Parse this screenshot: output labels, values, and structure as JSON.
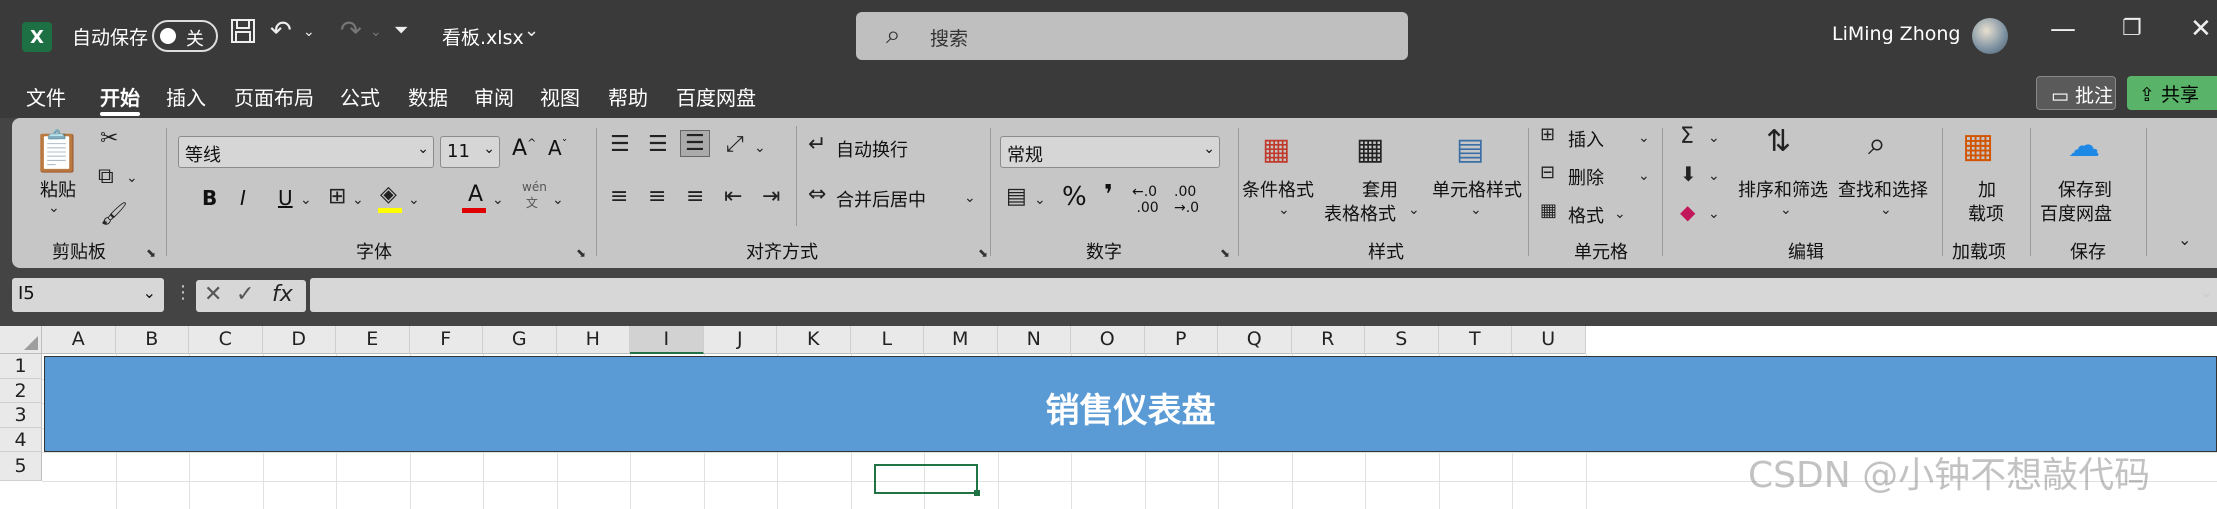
{
  "titlebar": {
    "autosave_label": "自动保存",
    "autosave_state": "关",
    "filename": "看板.xlsx",
    "search_placeholder": "搜索",
    "user_name": "LiMing Zhong"
  },
  "menu": {
    "tabs": [
      "文件",
      "开始",
      "插入",
      "页面布局",
      "公式",
      "数据",
      "审阅",
      "视图",
      "帮助",
      "百度网盘"
    ],
    "active_tab": "开始",
    "comment_label": "批注",
    "share_label": "共享"
  },
  "ribbon": {
    "clipboard": {
      "paste": "粘贴",
      "label": "剪贴板"
    },
    "font": {
      "name": "等线",
      "size": "11",
      "label": "字体",
      "bold": "B",
      "italic": "I",
      "underline": "U"
    },
    "alignment": {
      "wrap": "自动换行",
      "merge": "合并后居中",
      "label": "对齐方式"
    },
    "number": {
      "format": "常规",
      "percent": "%",
      "comma": "❜",
      "label": "数字"
    },
    "styles": {
      "conditional": "条件格式",
      "table_format_1": "套用",
      "table_format_2": "表格格式",
      "cell_styles": "单元格样式",
      "label": "样式"
    },
    "cells": {
      "insert": "插入",
      "delete": "删除",
      "format": "格式",
      "label": "单元格"
    },
    "editing": {
      "sort": "排序和筛选",
      "find": "查找和选择",
      "label": "编辑"
    },
    "addins": {
      "addin_1": "加",
      "addin_2": "载项",
      "label": "加载项"
    },
    "save": {
      "save_1": "保存到",
      "save_2": "百度网盘",
      "label": "保存"
    }
  },
  "formula_bar": {
    "name_box": "I5",
    "fx": "fx",
    "content": ""
  },
  "grid": {
    "columns": [
      "A",
      "B",
      "C",
      "D",
      "E",
      "F",
      "G",
      "H",
      "I",
      "J",
      "K",
      "L",
      "M",
      "N",
      "O",
      "P",
      "Q",
      "R",
      "S",
      "T",
      "U"
    ],
    "rows": [
      "1",
      "2",
      "3",
      "4",
      "5"
    ],
    "selected_column": "I",
    "banner_text": "销售仪表盘",
    "banner_color": "#5b9bd5",
    "active_cell": "I5"
  },
  "watermark": "CSDN @小钟不想敲代码",
  "colors": {
    "accent_green": "#217346",
    "share_green": "#59b368"
  }
}
